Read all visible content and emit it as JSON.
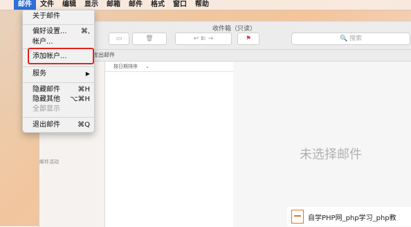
{
  "menubar": {
    "items": [
      "邮件",
      "文件",
      "编辑",
      "显示",
      "邮箱",
      "邮件",
      "格式",
      "窗口",
      "帮助"
    ]
  },
  "dropdown": {
    "about": "关于邮件",
    "preferences": "偏好设置...",
    "preferences_shortcut": "⌘,",
    "accounts": "帐户...",
    "add_account": "添加帐户...",
    "services": "服务",
    "hide_mail": "隐藏邮件",
    "hide_mail_shortcut": "⌘H",
    "hide_others": "隐藏其他",
    "hide_others_shortcut": "⌥⌘H",
    "show_all": "全部显示",
    "quit": "退出邮件",
    "quit_shortcut": "⌘Q"
  },
  "window": {
    "title": "收件箱（只读）",
    "search_placeholder": "搜索",
    "favbar_item": "已发出邮件",
    "sort_label": "按日期排序",
    "sidebar_section": "邮件活动",
    "no_selection": "未选择邮件"
  },
  "watermark": {
    "text": "自学PHP网_php学习_php教"
  }
}
